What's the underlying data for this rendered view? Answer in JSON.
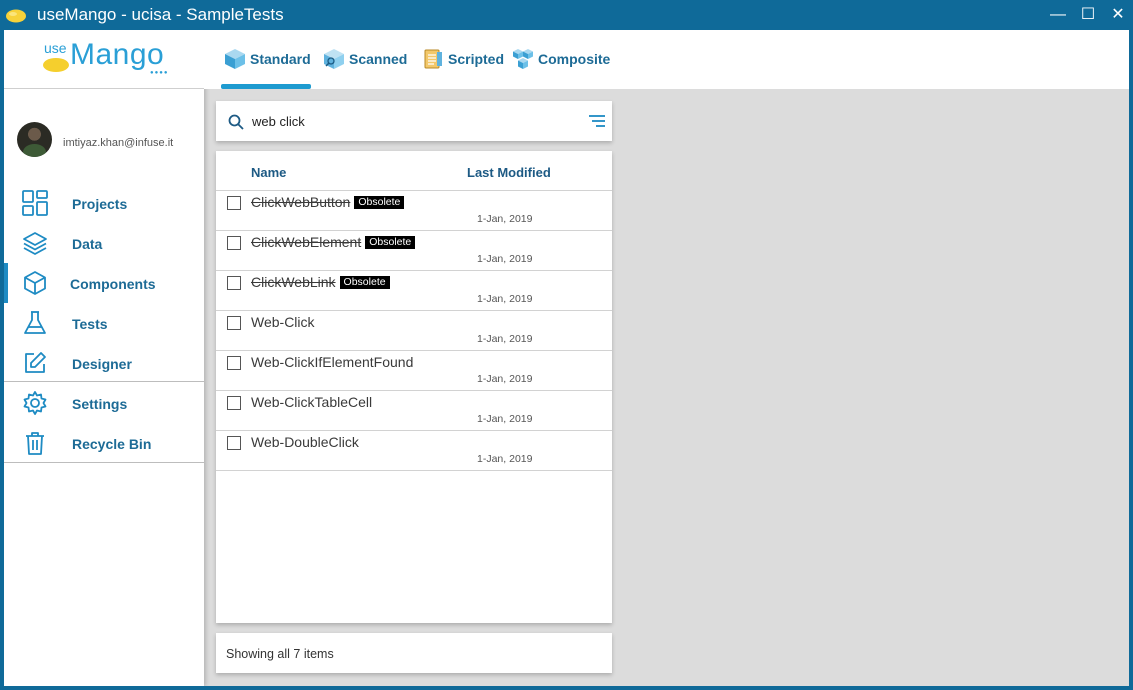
{
  "window": {
    "title": "useMango - ucisa - SampleTests",
    "minimize": "—",
    "maximize": "☐",
    "close": "✕"
  },
  "logo": {
    "use": "use",
    "mango": "Mango",
    "dots": "●●●●"
  },
  "user": {
    "email": "imtiyaz.khan@infuse.it"
  },
  "sidebar": {
    "items": [
      {
        "label": "Projects",
        "icon": "projects-grid-icon"
      },
      {
        "label": "Data",
        "icon": "layers-icon"
      },
      {
        "label": "Components",
        "icon": "cube-icon",
        "active": true
      },
      {
        "label": "Tests",
        "icon": "flask-icon"
      },
      {
        "label": "Designer",
        "icon": "edit-icon"
      },
      {
        "label": "Settings",
        "icon": "gear-icon"
      },
      {
        "label": "Recycle Bin",
        "icon": "trash-icon"
      }
    ]
  },
  "tabs": [
    {
      "label": "Standard",
      "icon": "standard-cube-icon",
      "active": true
    },
    {
      "label": "Scanned",
      "icon": "scanned-cube-icon"
    },
    {
      "label": "Scripted",
      "icon": "scripted-doc-icon"
    },
    {
      "label": "Composite",
      "icon": "composite-cube-icon"
    }
  ],
  "search": {
    "value": "web click",
    "placeholder": ""
  },
  "list": {
    "headers": {
      "name": "Name",
      "modified": "Last Modified"
    },
    "badge": "Obsolete",
    "rows": [
      {
        "name": "ClickWebButton",
        "obsolete": true,
        "modified": "1-Jan, 2019"
      },
      {
        "name": "ClickWebElement",
        "obsolete": true,
        "modified": "1-Jan, 2019"
      },
      {
        "name": "ClickWebLink",
        "obsolete": true,
        "modified": "1-Jan, 2019"
      },
      {
        "name": "Web-Click",
        "obsolete": false,
        "modified": "1-Jan, 2019"
      },
      {
        "name": "Web-ClickIfElementFound",
        "obsolete": false,
        "modified": "1-Jan, 2019"
      },
      {
        "name": "Web-ClickTableCell",
        "obsolete": false,
        "modified": "1-Jan, 2019"
      },
      {
        "name": "Web-DoubleClick",
        "obsolete": false,
        "modified": "1-Jan, 2019"
      }
    ]
  },
  "status": {
    "text": "Showing all 7 items"
  },
  "colors": {
    "accent": "#1e8bc3",
    "titlebar": "#0f6a99",
    "navText": "#1d6b96",
    "badge": "#000000"
  }
}
